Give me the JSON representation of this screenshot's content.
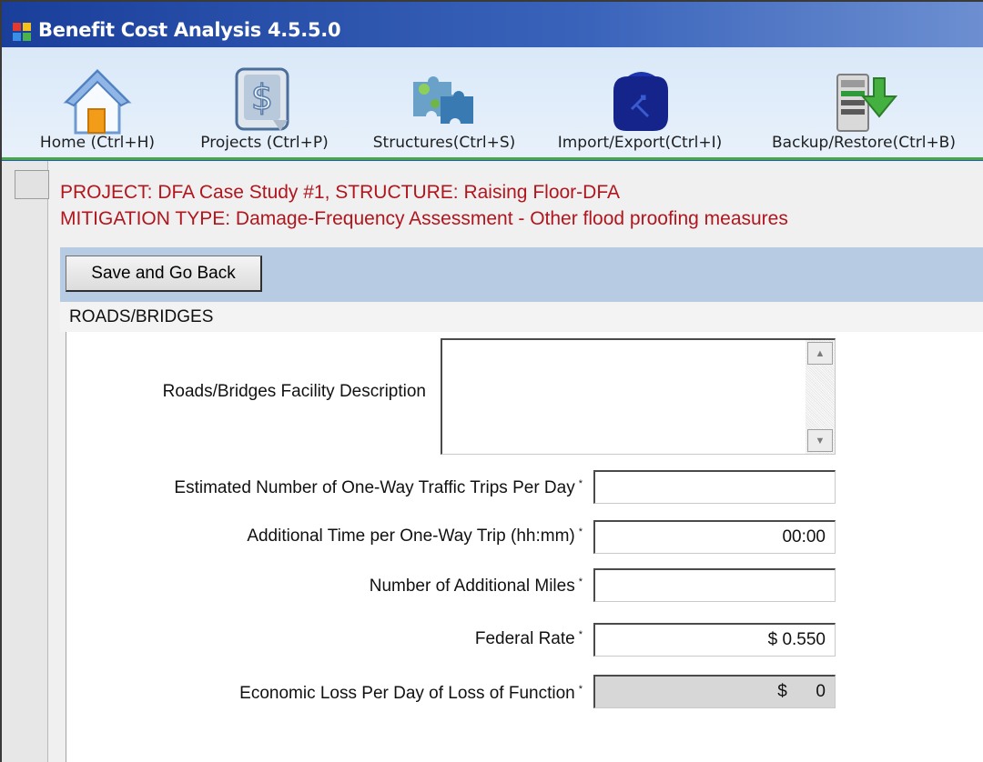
{
  "window": {
    "title": "Benefit Cost Analysis 4.5.5.0",
    "icon": "app-window-icon"
  },
  "toolbar": {
    "items": [
      {
        "label": "Home (Ctrl+H)",
        "icon": "home-icon"
      },
      {
        "label": "Projects (Ctrl+P)",
        "icon": "projects-dollar-doc-icon"
      },
      {
        "label": "Structures(Ctrl+S)",
        "icon": "structures-puzzle-icon"
      },
      {
        "label": "Import/Export(Ctrl+I)",
        "icon": "import-export-icon"
      },
      {
        "label": "Backup/Restore(Ctrl+B)",
        "icon": "backup-restore-icon"
      }
    ],
    "accent_color": "#48a74c"
  },
  "header": {
    "project_line": "PROJECT: DFA Case Study #1, STRUCTURE: Raising Floor-DFA",
    "mitigation_line": "MITIGATION TYPE: Damage-Frequency Assessment - Other flood proofing measures",
    "color": "#b0161e"
  },
  "actions": {
    "save_label": "Save and Go Back"
  },
  "section": {
    "title": "ROADS/BRIDGES"
  },
  "form": {
    "description": {
      "label": "Roads/Bridges Facility Description",
      "value": ""
    },
    "trips": {
      "label": "Estimated Number of One-Way Traffic Trips Per Day",
      "value": ""
    },
    "time": {
      "label": "Additional Time per One-Way Trip (hh:mm)",
      "value": "00:00"
    },
    "miles": {
      "label": "Number of Additional Miles",
      "value": ""
    },
    "rate": {
      "label": "Federal Rate",
      "value": "$ 0.550"
    },
    "loss": {
      "label": "Economic Loss Per Day of Loss of Function",
      "value": "$      0"
    },
    "required_marker": "*"
  }
}
